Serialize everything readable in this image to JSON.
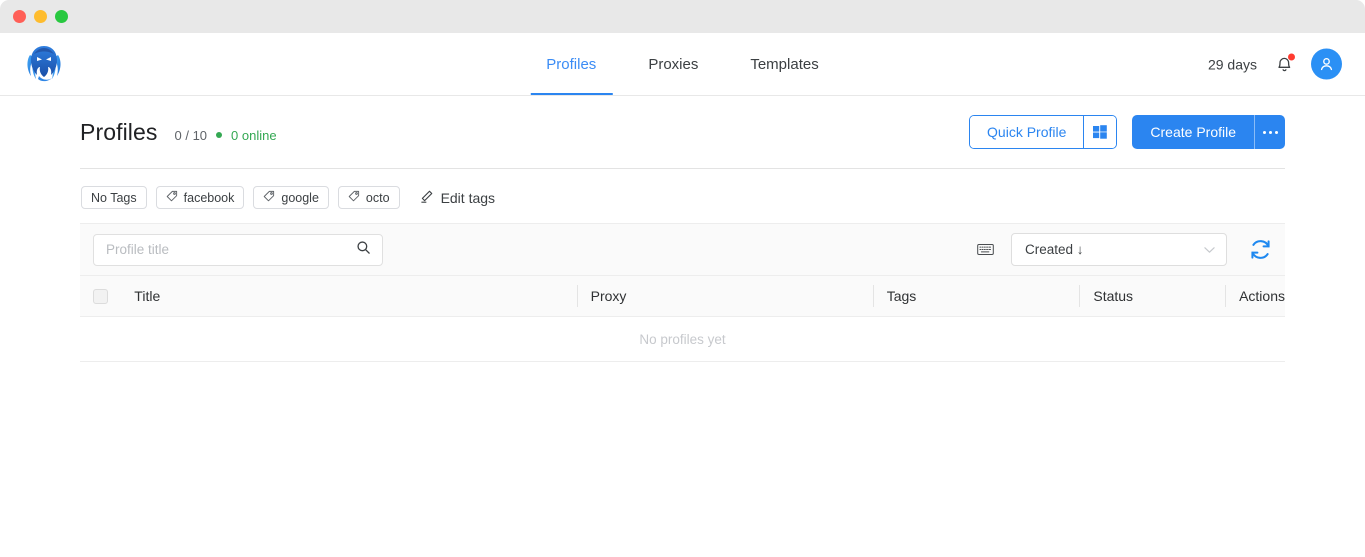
{
  "window": {
    "traffic_lights": [
      "close",
      "minimize",
      "maximize"
    ]
  },
  "topnav": {
    "logo_name": "octo-browser-logo",
    "items": [
      {
        "label": "Profiles",
        "active": true
      },
      {
        "label": "Proxies",
        "active": false
      },
      {
        "label": "Templates",
        "active": false
      }
    ],
    "trial_days": "29 days",
    "notification_icon": "bell-icon",
    "has_notification": true,
    "avatar_icon": "user-avatar-icon"
  },
  "page": {
    "title": "Profiles",
    "count_total": "0 / 10",
    "count_online": "0 online",
    "online_dot_color": "#34a853",
    "accent_color": "#2b85f0"
  },
  "actions": {
    "quick_profile_label": "Quick Profile",
    "quick_profile_os_icon": "windows-icon",
    "create_profile_label": "Create Profile",
    "more_icon": "ellipsis-icon"
  },
  "tags": {
    "chips": [
      {
        "label": "No Tags",
        "has_icon": false
      },
      {
        "label": "facebook",
        "has_icon": true
      },
      {
        "label": "google",
        "has_icon": true
      },
      {
        "label": "octo",
        "has_icon": true
      }
    ],
    "edit_label": "Edit tags",
    "edit_icon": "pencil-icon"
  },
  "filters": {
    "search_placeholder": "Profile title",
    "search_value": "",
    "search_icon": "search-icon",
    "keyboard_icon": "keyboard-icon",
    "sort_value": "Created ↓",
    "sort_chevron_icon": "chevron-down-icon",
    "refresh_icon": "refresh-icon"
  },
  "table": {
    "columns": [
      "Title",
      "Proxy",
      "Tags",
      "Status",
      "Actions"
    ],
    "rows": [],
    "empty_text": "No profiles yet"
  }
}
